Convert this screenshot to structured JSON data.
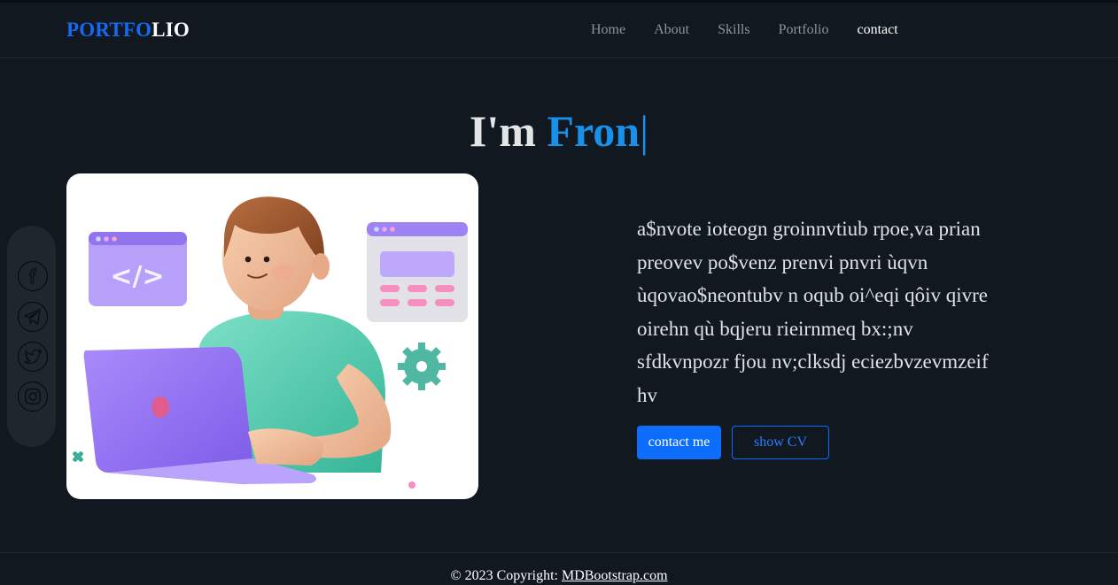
{
  "brand": {
    "part1": "PORTFO",
    "part2": "LIO"
  },
  "nav": {
    "items": [
      {
        "label": "Home"
      },
      {
        "label": "About"
      },
      {
        "label": "Skills"
      },
      {
        "label": "Portfolio"
      },
      {
        "label": "contact"
      }
    ],
    "active_index": 4
  },
  "hero": {
    "prefix": "I'm ",
    "typed": "Fron",
    "caret": "|"
  },
  "social": {
    "icons": [
      "facebook-icon",
      "telegram-icon",
      "twitter-icon",
      "instagram-icon"
    ]
  },
  "description": "a$nvote ioteogn groinnvtiub rpoe,va prian preovev po$venz prenvi pnvri ùqvn ùqovao$neontubv n oqub oi^eqi qôiv qivre oirehn qù bqjeru rieirnmeq bx:;nv sfdkvnpozr fjou nv;clksdj eciezbvzevmzeif hv",
  "buttons": {
    "contact": "contact me",
    "cv": "show CV"
  },
  "footer": {
    "text": "© 2023 Copyright: ",
    "link": "MDBootstrap.com"
  },
  "colors": {
    "background": "#111820",
    "accent": "#1991ea",
    "brand": "#1669f2",
    "primary_button": "#0d6efd"
  }
}
